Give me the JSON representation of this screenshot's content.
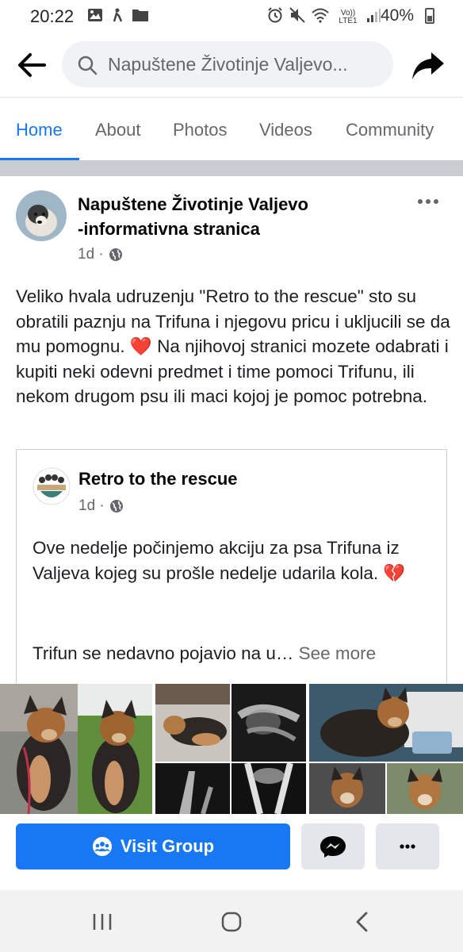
{
  "status_bar": {
    "time": "20:22",
    "network": "Vo)) LTE1",
    "battery": "40%"
  },
  "header": {
    "search_text": "Napuštene Životinje Valjevo...",
    "back_icon": "arrow-left-icon",
    "share_icon": "share-arrow-icon"
  },
  "tabs": [
    {
      "label": "Home",
      "active": true
    },
    {
      "label": "About",
      "active": false
    },
    {
      "label": "Photos",
      "active": false
    },
    {
      "label": "Videos",
      "active": false
    },
    {
      "label": "Community",
      "active": false
    }
  ],
  "post": {
    "author_line1": "Napuštene Životinje Valjevo",
    "author_line2": "-informativna stranica",
    "time": "1d ·",
    "text": "Veliko hvala udruzenju \"Retro to the rescue\" sto su obratili paznju na Trifuna i njegovu pricu i ukljucili se da mu pomognu. ❤️ Na njihovoj stranici mozete odabrati i kupiti neki odevni predmet i time pomoci Trifunu, ili nekom drugom psu ili maci kojoj je pomoc potrebna."
  },
  "shared_post": {
    "author": "Retro to the rescue",
    "time": "1d ·",
    "text": "Ove nedelje počinjemo akciju za psa Trifuna iz Valjeva kojeg su prošle nedelje udarila kola. 💔",
    "text2": "Trifun se nedavno pojavio na u…",
    "see_more": "See more"
  },
  "buttons": {
    "visit_group": "Visit Group",
    "messenger_icon": "messenger-icon",
    "more_icon": "more-dots-icon"
  },
  "colors": {
    "brand_blue": "#1877f2",
    "muted_text": "#65676b",
    "button_gray": "#e4e6eb"
  }
}
